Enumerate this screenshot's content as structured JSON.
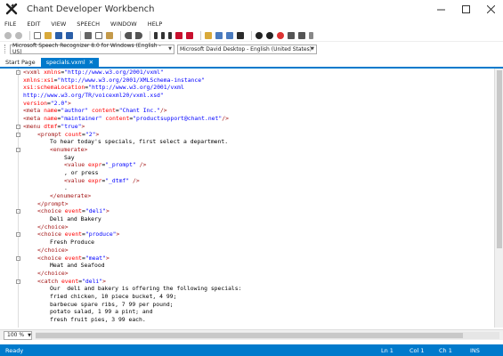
{
  "window": {
    "title": "Chant Developer Workbench"
  },
  "menu": [
    "FILE",
    "EDIT",
    "VIEW",
    "SPEECH",
    "WINDOW",
    "HELP"
  ],
  "voice": {
    "recognizer": "Microsoft Speech Recognizer 8.0 for Windows (English - US)",
    "synthesizer": "Microsoft David Desktop - English (United States)"
  },
  "tabs": [
    {
      "label": "Start Page",
      "active": false
    },
    {
      "label": "specials.vxml",
      "active": true
    }
  ],
  "editor": {
    "lines": [
      {
        "fold": "-",
        "indent": 0,
        "tokens": [
          {
            "t": "tag",
            "s": "<vxml "
          },
          {
            "t": "attr",
            "s": "xmlns"
          },
          {
            "t": "txt",
            "s": "="
          },
          {
            "t": "val",
            "s": "\"http://www.w3.org/2001/vxml\""
          }
        ]
      },
      {
        "indent": 0,
        "tokens": [
          {
            "t": "attr",
            "s": "xmlns:xsi"
          },
          {
            "t": "txt",
            "s": "="
          },
          {
            "t": "val",
            "s": "\"http://www.w3.org/2001/XMLSchema-instance\""
          }
        ]
      },
      {
        "indent": 0,
        "tokens": [
          {
            "t": "attr",
            "s": "xsi:schemaLocation"
          },
          {
            "t": "txt",
            "s": "="
          },
          {
            "t": "val",
            "s": "\"http://www.w3.org/2001/vxml"
          }
        ]
      },
      {
        "indent": 0,
        "tokens": [
          {
            "t": "val",
            "s": "http://www.w3.org/TR/voicexml20/vxml.xsd\""
          }
        ]
      },
      {
        "indent": 0,
        "tokens": [
          {
            "t": "attr",
            "s": "version"
          },
          {
            "t": "txt",
            "s": "="
          },
          {
            "t": "val",
            "s": "\"2.0\""
          },
          {
            "t": "tag",
            "s": ">"
          }
        ]
      },
      {
        "indent": 0,
        "tokens": [
          {
            "t": "tag",
            "s": "<meta "
          },
          {
            "t": "attr",
            "s": "name"
          },
          {
            "t": "txt",
            "s": "="
          },
          {
            "t": "val",
            "s": "\"author\""
          },
          {
            "t": "txt",
            "s": " "
          },
          {
            "t": "attr",
            "s": "content"
          },
          {
            "t": "txt",
            "s": "="
          },
          {
            "t": "val",
            "s": "\"Chant Inc.\""
          },
          {
            "t": "tag",
            "s": "/>"
          }
        ]
      },
      {
        "indent": 0,
        "tokens": [
          {
            "t": "tag",
            "s": "<meta "
          },
          {
            "t": "attr",
            "s": "name"
          },
          {
            "t": "txt",
            "s": "="
          },
          {
            "t": "val",
            "s": "\"maintainer\""
          },
          {
            "t": "txt",
            "s": " "
          },
          {
            "t": "attr",
            "s": "content"
          },
          {
            "t": "txt",
            "s": "="
          },
          {
            "t": "val",
            "s": "\"productsupport@chant.net\""
          },
          {
            "t": "tag",
            "s": "/>"
          }
        ]
      },
      {
        "fold": "-",
        "indent": 0,
        "tokens": [
          {
            "t": "tag",
            "s": "<menu "
          },
          {
            "t": "attr",
            "s": "dtmf"
          },
          {
            "t": "txt",
            "s": "="
          },
          {
            "t": "val",
            "s": "\"true\""
          },
          {
            "t": "tag",
            "s": ">"
          }
        ]
      },
      {
        "fold": "-",
        "indent": 1,
        "tokens": [
          {
            "t": "tag",
            "s": "<prompt "
          },
          {
            "t": "attr",
            "s": "count"
          },
          {
            "t": "txt",
            "s": "="
          },
          {
            "t": "val",
            "s": "\"2\""
          },
          {
            "t": "tag",
            "s": ">"
          }
        ]
      },
      {
        "indent": 2,
        "tokens": [
          {
            "t": "txt",
            "s": "To hear today's specials, first select a department."
          }
        ]
      },
      {
        "fold": "-",
        "indent": 2,
        "tokens": [
          {
            "t": "tag",
            "s": "<enumerate>"
          }
        ]
      },
      {
        "indent": 3,
        "tokens": [
          {
            "t": "txt",
            "s": "Say"
          }
        ]
      },
      {
        "indent": 3,
        "tokens": [
          {
            "t": "tag",
            "s": "<value "
          },
          {
            "t": "attr",
            "s": "expr"
          },
          {
            "t": "txt",
            "s": "="
          },
          {
            "t": "val",
            "s": "\"_prompt\""
          },
          {
            "t": "tag",
            "s": " />"
          }
        ]
      },
      {
        "indent": 3,
        "tokens": [
          {
            "t": "txt",
            "s": ", or press"
          }
        ]
      },
      {
        "indent": 3,
        "tokens": [
          {
            "t": "tag",
            "s": "<value "
          },
          {
            "t": "attr",
            "s": "expr"
          },
          {
            "t": "txt",
            "s": "="
          },
          {
            "t": "val",
            "s": "\"_dtmf\""
          },
          {
            "t": "tag",
            "s": " />"
          }
        ]
      },
      {
        "indent": 3,
        "tokens": [
          {
            "t": "txt",
            "s": "."
          }
        ]
      },
      {
        "indent": 2,
        "tokens": [
          {
            "t": "tag",
            "s": "</enumerate>"
          }
        ]
      },
      {
        "indent": 1,
        "tokens": [
          {
            "t": "tag",
            "s": "</prompt>"
          }
        ]
      },
      {
        "fold": "-",
        "indent": 1,
        "tokens": [
          {
            "t": "tag",
            "s": "<choice "
          },
          {
            "t": "attr",
            "s": "event"
          },
          {
            "t": "txt",
            "s": "="
          },
          {
            "t": "val",
            "s": "\"deli\""
          },
          {
            "t": "tag",
            "s": ">"
          }
        ]
      },
      {
        "indent": 2,
        "tokens": [
          {
            "t": "txt",
            "s": "Deli and Bakery"
          }
        ]
      },
      {
        "indent": 1,
        "tokens": [
          {
            "t": "tag",
            "s": "</choice>"
          }
        ]
      },
      {
        "fold": "-",
        "indent": 1,
        "tokens": [
          {
            "t": "tag",
            "s": "<choice "
          },
          {
            "t": "attr",
            "s": "event"
          },
          {
            "t": "txt",
            "s": "="
          },
          {
            "t": "val",
            "s": "\"produce\""
          },
          {
            "t": "tag",
            "s": ">"
          }
        ]
      },
      {
        "indent": 2,
        "tokens": [
          {
            "t": "txt",
            "s": "Fresh Produce"
          }
        ]
      },
      {
        "indent": 1,
        "tokens": [
          {
            "t": "tag",
            "s": "</choice>"
          }
        ]
      },
      {
        "fold": "-",
        "indent": 1,
        "tokens": [
          {
            "t": "tag",
            "s": "<choice "
          },
          {
            "t": "attr",
            "s": "event"
          },
          {
            "t": "txt",
            "s": "="
          },
          {
            "t": "val",
            "s": "\"meat\""
          },
          {
            "t": "tag",
            "s": ">"
          }
        ]
      },
      {
        "indent": 2,
        "tokens": [
          {
            "t": "txt",
            "s": "Meat and Seafood"
          }
        ]
      },
      {
        "indent": 1,
        "tokens": [
          {
            "t": "tag",
            "s": "</choice>"
          }
        ]
      },
      {
        "fold": "-",
        "indent": 1,
        "tokens": [
          {
            "t": "tag",
            "s": "<catch "
          },
          {
            "t": "attr",
            "s": "event"
          },
          {
            "t": "txt",
            "s": "="
          },
          {
            "t": "val",
            "s": "\"deli\""
          },
          {
            "t": "tag",
            "s": ">"
          }
        ]
      },
      {
        "indent": 2,
        "tokens": [
          {
            "t": "txt",
            "s": "Our  deli and bakery is offering the following specials:"
          }
        ]
      },
      {
        "indent": 2,
        "tokens": [
          {
            "t": "txt",
            "s": "fried chicken, 10 piece bucket, 4 99;"
          }
        ]
      },
      {
        "indent": 2,
        "tokens": [
          {
            "t": "txt",
            "s": "barbecue spare ribs, 7 99 per pound;"
          }
        ]
      },
      {
        "indent": 2,
        "tokens": [
          {
            "t": "txt",
            "s": "potato salad, 1 99 a pint; and"
          }
        ]
      },
      {
        "indent": 2,
        "tokens": [
          {
            "t": "txt",
            "s": "fresh fruit pies, 3 99 each."
          }
        ]
      }
    ]
  },
  "zoom": "100 %",
  "status": {
    "ready": "Ready",
    "line": "Ln 1",
    "col": "Col 1",
    "ch": "Ch 1",
    "mode": "INS"
  },
  "colors": {
    "accent": "#007acc",
    "xml_tag": "#a31515",
    "xml_attr": "#ff0000",
    "xml_value": "#0000ff"
  }
}
